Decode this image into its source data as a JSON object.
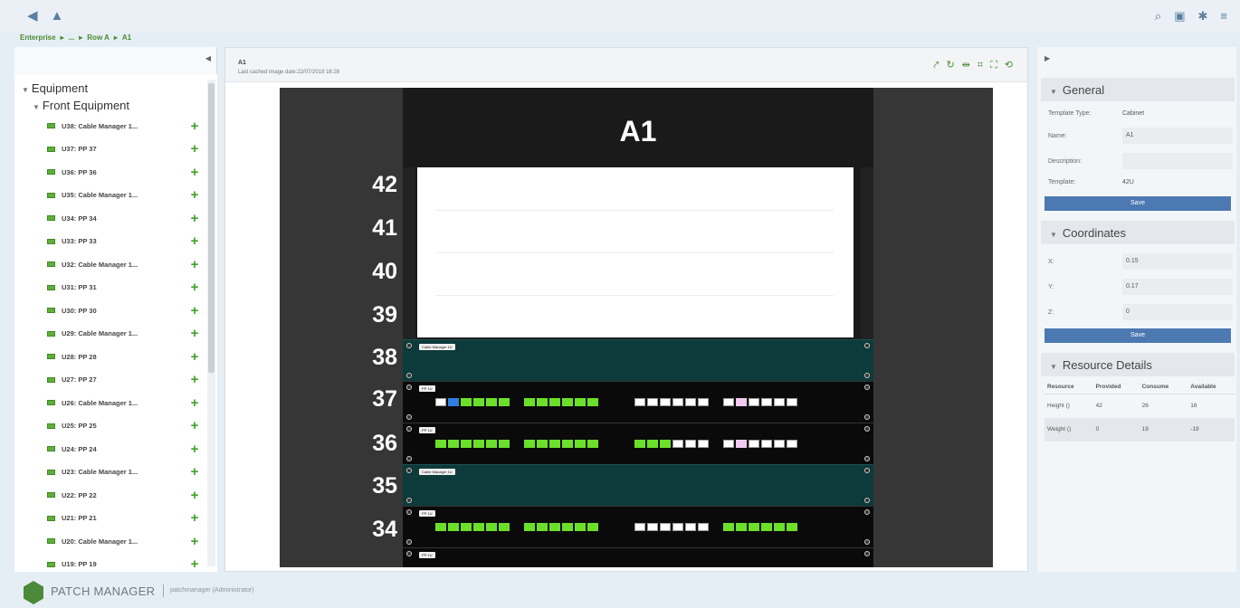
{
  "nav": {
    "back": "◆",
    "up": "⬆"
  },
  "top_icons": [
    "search-icon",
    "export-icon",
    "settings-icon",
    "menu-icon"
  ],
  "breadcrumb": [
    "Enterprise",
    "...",
    "Row A",
    "A1"
  ],
  "tree": {
    "root": "Equipment",
    "sub": "Front Equipment",
    "items": [
      "U38: Cable Manager 1...",
      "U37: PP 37",
      "U36: PP 36",
      "U35: Cable Manager 1...",
      "U34: PP 34",
      "U33: PP 33",
      "U32: Cable Manager 1...",
      "U31: PP 31",
      "U30: PP 30",
      "U29: Cable Manager 1...",
      "U28: PP 28",
      "U27: PP 27",
      "U26: Cable Manager 1...",
      "U25: PP 25",
      "U24: PP 24",
      "U23: Cable Manager 1...",
      "U22: PP 22",
      "U21: PP 21",
      "U20: Cable Manager 1...",
      "U19: PP 19"
    ]
  },
  "center": {
    "title": "A1",
    "subtitle": "Last cached image date:22/07/2019 16:28",
    "rack_title": "A1",
    "units": [
      "42",
      "41",
      "40",
      "39",
      "38",
      "37",
      "36",
      "35",
      "34"
    ],
    "cable_manager_tag": "Cable Manager 1U",
    "pp_tag": "PP 1U"
  },
  "general": {
    "header": "General",
    "template_type_label": "Template Type:",
    "template_type_value": "Cabinet",
    "name_label": "Name:",
    "name_value": "A1",
    "description_label": "Description:",
    "description_value": "",
    "template_label": "Template:",
    "template_value": "42U",
    "save": "Save"
  },
  "coordinates": {
    "header": "Coordinates",
    "x_label": "X:",
    "x_value": "0.15",
    "y_label": "Y:",
    "y_value": "0.17",
    "z_label": "Z:",
    "z_value": "0",
    "save": "Save"
  },
  "resources": {
    "header": "Resource Details",
    "columns": [
      "Resource",
      "Provided",
      "Consume",
      "Available"
    ],
    "rows": [
      [
        "Height ()",
        "42",
        "26",
        "16"
      ],
      [
        "Weight ()",
        "0",
        "19",
        "-19"
      ]
    ]
  },
  "footer": {
    "product": "PATCH MANAGER",
    "user": "patchmanager (Administrator)"
  },
  "colors": {
    "accent": "#4a8c2f",
    "button": "#4d79b3",
    "rack": "#1a1a1a",
    "cable_manager": "#0d3a3a"
  }
}
